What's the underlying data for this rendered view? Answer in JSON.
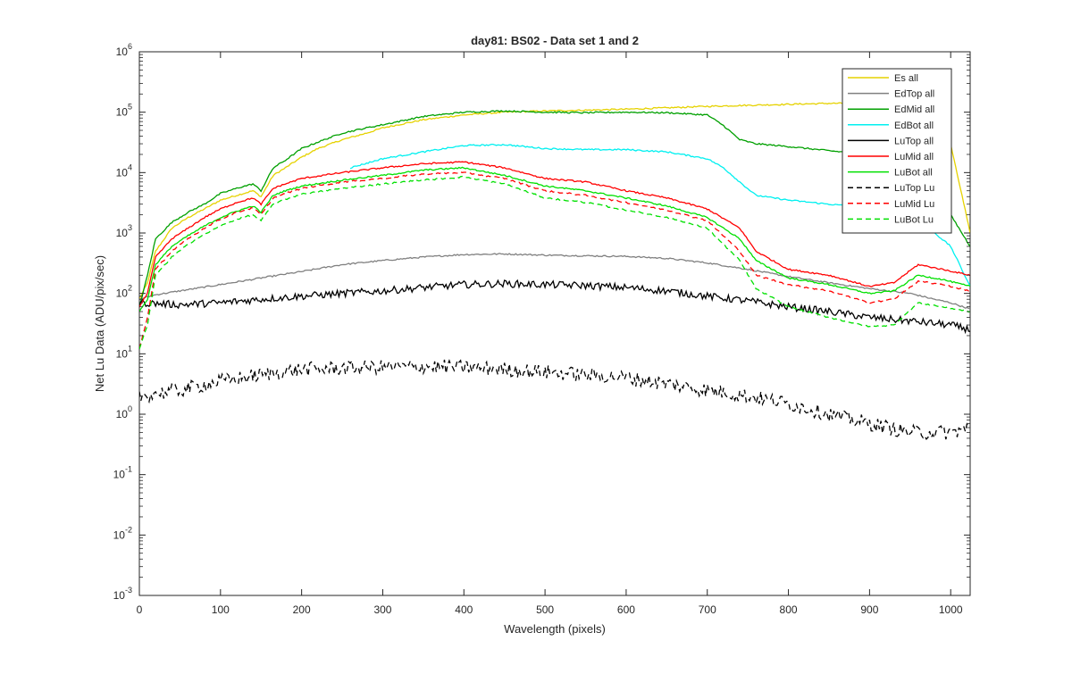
{
  "chart_data": {
    "type": "line",
    "title": "day81: BS02 - Data set 1 and 2",
    "xlabel": "Wavelength (pixels)",
    "ylabel": "Net Lu Data (ADU/pix/sec)",
    "xlim": [
      0,
      1024
    ],
    "ylim": [
      0.001,
      1000000
    ],
    "yscale": "log",
    "grid": false,
    "legend_position": "top-right",
    "x_ticks": [
      "0",
      "100",
      "200",
      "300",
      "400",
      "500",
      "600",
      "700",
      "800",
      "900",
      "1000"
    ],
    "y_ticks": [
      {
        "base": "10",
        "exp": "-3"
      },
      {
        "base": "10",
        "exp": "-2"
      },
      {
        "base": "10",
        "exp": "-1"
      },
      {
        "base": "10",
        "exp": "0"
      },
      {
        "base": "10",
        "exp": "1"
      },
      {
        "base": "10",
        "exp": "2"
      },
      {
        "base": "10",
        "exp": "3"
      },
      {
        "base": "10",
        "exp": "4"
      },
      {
        "base": "10",
        "exp": "5"
      },
      {
        "base": "10",
        "exp": "6"
      }
    ],
    "series": [
      {
        "name": "Es  all",
        "color": "#e6d200",
        "style": "solid",
        "x": [
          0,
          10,
          20,
          40,
          60,
          80,
          100,
          120,
          140,
          150,
          165,
          180,
          200,
          220,
          250,
          280,
          300,
          350,
          400,
          450,
          500,
          550,
          600,
          650,
          700,
          750,
          800,
          850,
          900,
          950,
          1000,
          1024
        ],
        "y": [
          80,
          150,
          500,
          1200,
          1800,
          2500,
          3500,
          4200,
          5000,
          4000,
          9000,
          12000,
          18000,
          25000,
          35000,
          45000,
          55000,
          75000,
          90000,
          100000,
          105000,
          108000,
          112000,
          118000,
          125000,
          130000,
          135000,
          140000,
          140000,
          140000,
          30000,
          1000
        ]
      },
      {
        "name": "EdTop  all",
        "color": "#808080",
        "style": "solid",
        "x": [
          0,
          20,
          50,
          100,
          150,
          200,
          250,
          300,
          350,
          400,
          450,
          500,
          550,
          600,
          650,
          700,
          750,
          800,
          850,
          900,
          950,
          980,
          1000,
          1024
        ],
        "y": [
          80,
          95,
          110,
          140,
          180,
          230,
          300,
          350,
          400,
          440,
          450,
          430,
          420,
          410,
          380,
          320,
          250,
          190,
          150,
          120,
          100,
          80,
          70,
          55
        ]
      },
      {
        "name": "EdMid  all",
        "color": "#00a000",
        "style": "solid",
        "x": [
          0,
          10,
          20,
          40,
          60,
          80,
          100,
          120,
          140,
          150,
          165,
          180,
          200,
          220,
          250,
          280,
          300,
          350,
          400,
          450,
          500,
          550,
          600,
          650,
          700,
          720,
          740,
          760,
          800,
          850,
          900,
          950,
          1000,
          1024
        ],
        "y": [
          60,
          200,
          800,
          1500,
          2200,
          3000,
          4500,
          5500,
          6500,
          5000,
          12000,
          16000,
          25000,
          32000,
          45000,
          55000,
          62000,
          85000,
          100000,
          105000,
          100000,
          98000,
          100000,
          98000,
          90000,
          60000,
          35000,
          30000,
          27000,
          23000,
          20000,
          12000,
          2000,
          600
        ]
      },
      {
        "name": "EdBot  all",
        "color": "#00f0f0",
        "style": "solid",
        "x": [
          260,
          300,
          350,
          400,
          450,
          500,
          550,
          600,
          650,
          700,
          720,
          740,
          760,
          800,
          850,
          900,
          950,
          1000,
          1024
        ],
        "y": [
          12000,
          17000,
          22000,
          28000,
          29000,
          25000,
          24000,
          24000,
          22000,
          17000,
          12000,
          7000,
          4200,
          3500,
          3000,
          2600,
          2200,
          600,
          130
        ]
      },
      {
        "name": "LuTop  all",
        "color": "#000000",
        "style": "solid",
        "x": [
          0,
          50,
          100,
          150,
          200,
          250,
          300,
          350,
          400,
          450,
          500,
          550,
          600,
          650,
          700,
          750,
          800,
          850,
          900,
          950,
          1000,
          1024
        ],
        "y": [
          70,
          65,
          70,
          80,
          90,
          100,
          110,
          125,
          140,
          145,
          140,
          135,
          125,
          110,
          90,
          75,
          60,
          50,
          40,
          35,
          30,
          25
        ]
      },
      {
        "name": "LuMid  all",
        "color": "#ff0000",
        "style": "solid",
        "x": [
          0,
          10,
          20,
          40,
          60,
          80,
          100,
          120,
          140,
          150,
          165,
          180,
          200,
          250,
          300,
          350,
          400,
          450,
          500,
          550,
          600,
          650,
          700,
          740,
          760,
          800,
          850,
          900,
          930,
          960,
          990,
          1024
        ],
        "y": [
          60,
          100,
          400,
          800,
          1200,
          1800,
          2500,
          3200,
          3800,
          3000,
          5500,
          6500,
          8000,
          10000,
          12000,
          14000,
          15000,
          12000,
          8000,
          7000,
          5000,
          3800,
          2500,
          1200,
          500,
          250,
          200,
          130,
          150,
          300,
          250,
          200
        ]
      },
      {
        "name": "LuBot  all",
        "color": "#00e000",
        "style": "solid",
        "x": [
          0,
          10,
          20,
          40,
          60,
          80,
          100,
          120,
          140,
          150,
          165,
          180,
          200,
          250,
          300,
          350,
          400,
          450,
          500,
          550,
          600,
          650,
          700,
          740,
          760,
          800,
          850,
          900,
          930,
          960,
          990,
          1024
        ],
        "y": [
          50,
          80,
          300,
          600,
          900,
          1300,
          1800,
          2300,
          2800,
          2200,
          4200,
          5000,
          6000,
          7500,
          9000,
          11000,
          12000,
          9000,
          6000,
          5000,
          3800,
          2800,
          1800,
          800,
          350,
          180,
          140,
          100,
          110,
          200,
          170,
          130
        ]
      },
      {
        "name": "LuTop  Lu",
        "color": "#000000",
        "style": "dashed",
        "x": [
          0,
          50,
          100,
          150,
          200,
          250,
          300,
          350,
          400,
          450,
          500,
          550,
          600,
          650,
          700,
          750,
          800,
          850,
          900,
          950,
          1000,
          1024
        ],
        "y": [
          2.0,
          2.5,
          3.5,
          4.5,
          5.5,
          5.8,
          6.0,
          6.2,
          6.0,
          5.5,
          5.0,
          4.5,
          4.0,
          3.2,
          2.5,
          2.0,
          1.5,
          1.0,
          0.7,
          0.5,
          0.5,
          0.6
        ]
      },
      {
        "name": "LuMid  Lu",
        "color": "#ff0000",
        "style": "dashed",
        "x": [
          0,
          10,
          20,
          40,
          60,
          80,
          100,
          120,
          140,
          150,
          165,
          180,
          200,
          250,
          300,
          350,
          400,
          450,
          500,
          550,
          600,
          650,
          700,
          740,
          760,
          800,
          850,
          900,
          930,
          960,
          990,
          1024
        ],
        "y": [
          12,
          40,
          250,
          500,
          800,
          1200,
          1700,
          2200,
          2600,
          2000,
          3800,
          4500,
          5500,
          7000,
          8000,
          9500,
          10000,
          8000,
          5000,
          4200,
          3200,
          2400,
          1600,
          500,
          200,
          140,
          110,
          70,
          80,
          160,
          140,
          110
        ]
      },
      {
        "name": "LuBot  Lu",
        "color": "#00e000",
        "style": "dashed",
        "x": [
          0,
          10,
          20,
          40,
          60,
          80,
          100,
          120,
          140,
          150,
          165,
          180,
          200,
          250,
          300,
          350,
          400,
          450,
          500,
          550,
          600,
          650,
          700,
          740,
          760,
          800,
          850,
          900,
          930,
          960,
          990,
          1024
        ],
        "y": [
          12,
          30,
          200,
          400,
          650,
          950,
          1300,
          1700,
          2000,
          1600,
          3000,
          3600,
          4400,
          5500,
          6500,
          7500,
          8500,
          6500,
          3800,
          3200,
          2400,
          1800,
          1200,
          350,
          120,
          60,
          40,
          28,
          30,
          70,
          60,
          50
        ]
      }
    ]
  }
}
